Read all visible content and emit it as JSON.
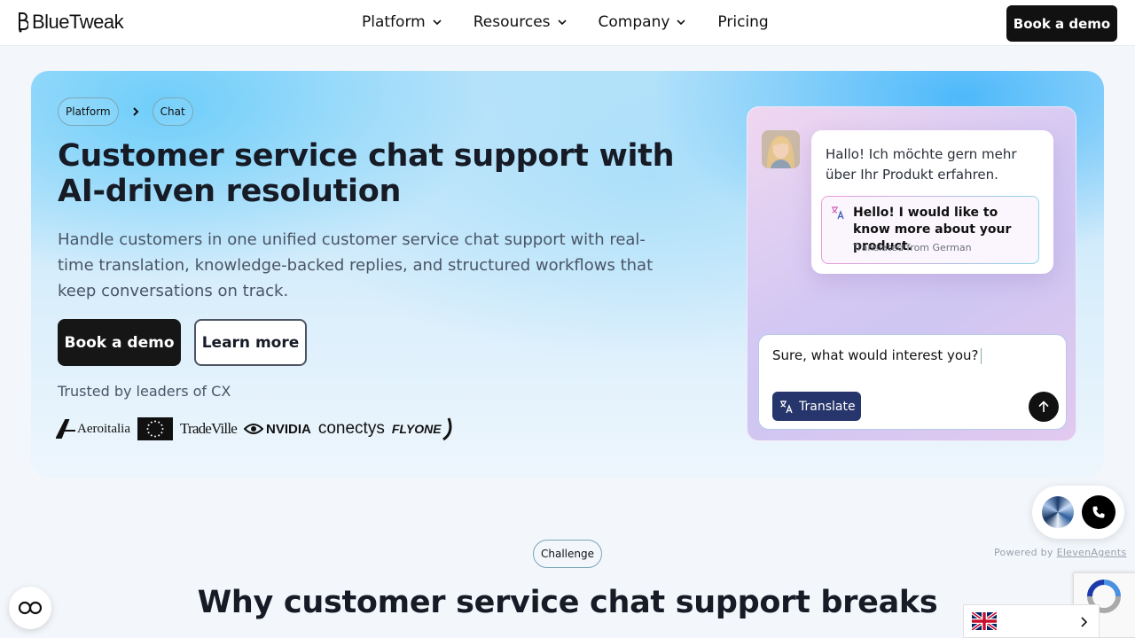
{
  "header": {
    "logo_text": "BlueTweak",
    "nav": [
      {
        "label": "Platform",
        "has_dropdown": true
      },
      {
        "label": "Resources",
        "has_dropdown": true
      },
      {
        "label": "Company",
        "has_dropdown": true
      },
      {
        "label": "Pricing",
        "has_dropdown": false
      }
    ],
    "cta_label": "Book a demo"
  },
  "hero": {
    "breadcrumb": [
      "Platform",
      "Chat"
    ],
    "title": "Customer service chat support with AI-driven resolution",
    "subtitle": "Handle customers in one unified customer service chat support with real-time translation, knowledge-backed replies, and structured workflows that keep conversations on track.",
    "primary_cta": "Book a demo",
    "secondary_cta": "Learn more",
    "trusted_label": "Trusted by leaders of CX",
    "partner_logos": [
      "Aeroitalia",
      "EU",
      "TradeVille",
      "NVIDIA",
      "conectys",
      "FLYONE"
    ]
  },
  "chat_card": {
    "incoming_message": "Hallo! Ich möchte gern mehr über Ihr Produkt erfahren.",
    "translated_message": "Hello! I would like to know more about your product.",
    "translation_note": "Translated from German",
    "reply_input": "Sure, what would interest you?",
    "translate_button": "Translate"
  },
  "section": {
    "badge": "Challenge",
    "title": "Why customer service chat support breaks"
  },
  "widgets": {
    "powered_by_prefix": "Powered by",
    "powered_by_link": "ElevenAgents",
    "language": "English"
  },
  "colors": {
    "primary_dark": "#161616",
    "translate_button": "#26356b",
    "hero_blue": "#5cc3f7"
  }
}
